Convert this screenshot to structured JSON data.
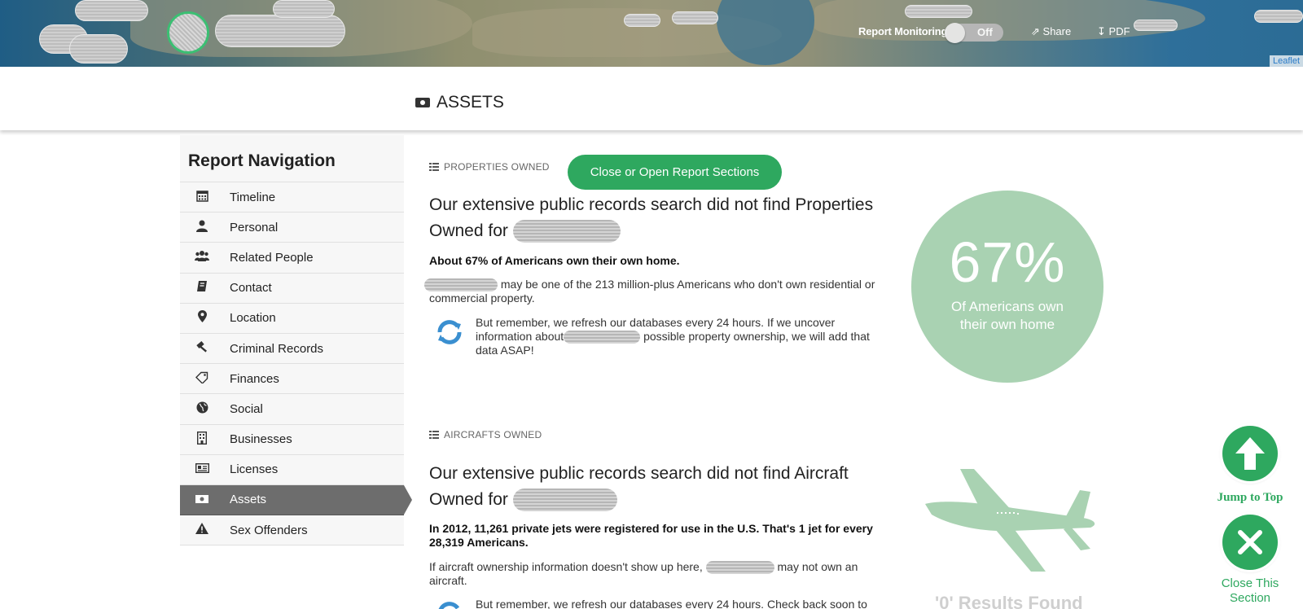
{
  "header": {
    "report_monitoring_label": "Report Monitoring",
    "monitoring_state": "Off",
    "share_label": "Share",
    "pdf_label": "PDF",
    "map_attribution": "Leaflet"
  },
  "section": {
    "title": "ASSETS"
  },
  "nav": {
    "heading": "Report Navigation",
    "items": [
      {
        "label": "Timeline",
        "icon": "calendar-icon"
      },
      {
        "label": "Personal",
        "icon": "person-icon"
      },
      {
        "label": "Related People",
        "icon": "users-icon"
      },
      {
        "label": "Contact",
        "icon": "address-book-icon"
      },
      {
        "label": "Location",
        "icon": "map-pin-icon"
      },
      {
        "label": "Criminal Records",
        "icon": "gavel-icon"
      },
      {
        "label": "Finances",
        "icon": "tag-icon"
      },
      {
        "label": "Social",
        "icon": "globe-icon"
      },
      {
        "label": "Businesses",
        "icon": "building-icon"
      },
      {
        "label": "Licenses",
        "icon": "id-card-icon"
      },
      {
        "label": "Assets",
        "icon": "money-icon",
        "active": true
      },
      {
        "label": "Sex Offenders",
        "icon": "warning-icon"
      }
    ]
  },
  "properties": {
    "category": "PROPERTIES OWNED",
    "toggle_button": "Close or Open Report Sections",
    "headline": "Our extensive public records search did not find Properties Owned for",
    "fact": "About 67% of Americans own their own home.",
    "para": "may be one of the 213 million-plus Americans who don't own residential or commercial property.",
    "refresh_pre": "But remember, we refresh our databases every 24 hours. If we uncover information about",
    "refresh_post": "possible property ownership, we will add that data ASAP!",
    "stat_value": "67%",
    "stat_caption": "Of Americans own their own home"
  },
  "aircraft": {
    "category": "AIRCRAFTS OWNED",
    "headline": "Our extensive public records search did not find Aircraft Owned for",
    "fact": "In 2012, 11,261 private jets were registered for use in the U.S. That's 1 jet for every 28,319 Americans.",
    "para_pre": "If aircraft ownership information doesn't show up here,",
    "para_post": "may not own an aircraft.",
    "refresh_partial": "But remember, we refresh our databases every 24 hours. Check back soon to",
    "results": "'0' Results Found"
  },
  "floating": {
    "jump_top": "Jump to Top",
    "close_section": "Close This Section"
  },
  "colors": {
    "accent_green": "#2ea85f",
    "stat_circle": "#a9d2b2",
    "nav_active": "#6d6d6d"
  }
}
